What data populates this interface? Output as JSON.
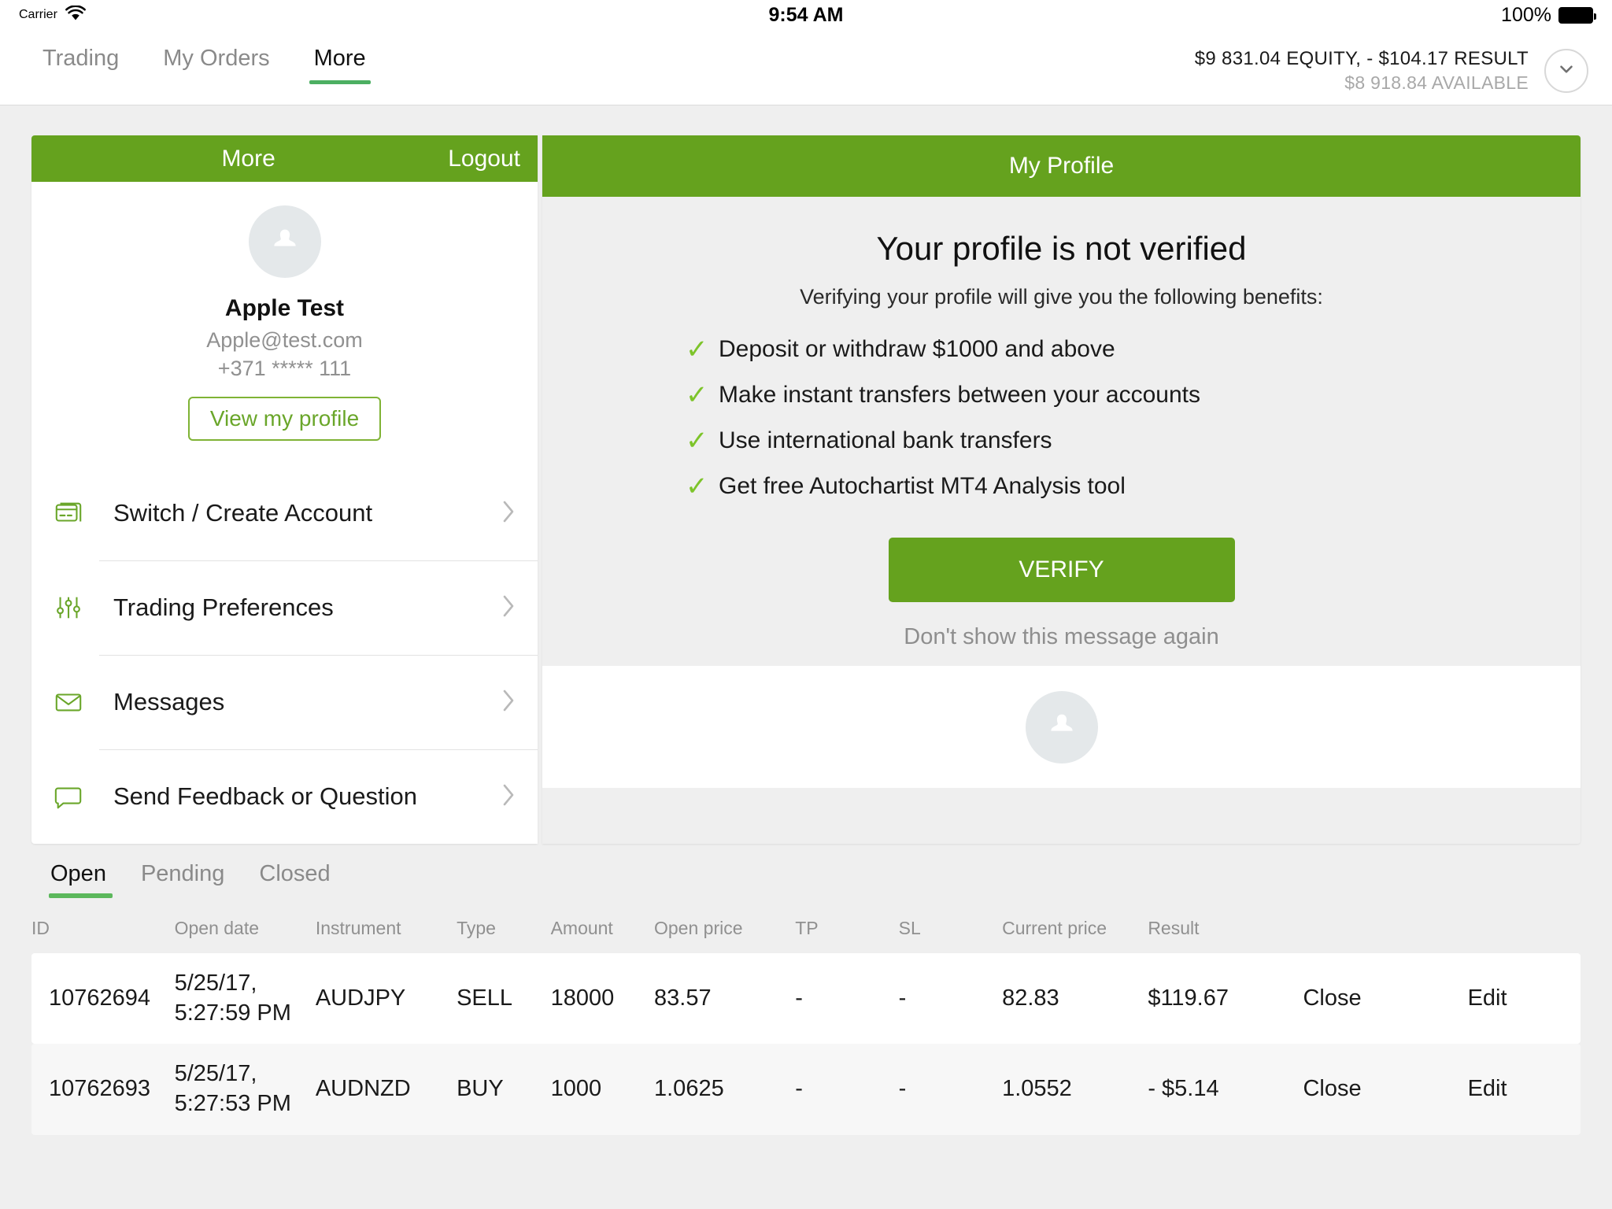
{
  "status_bar": {
    "carrier": "Carrier",
    "wifi_icon": "wifi-icon",
    "time": "9:54 AM",
    "battery_percent": "100%",
    "battery_icon": "battery-full-icon"
  },
  "top_nav": {
    "tabs": [
      {
        "label": "Trading",
        "active": false
      },
      {
        "label": "My Orders",
        "active": false
      },
      {
        "label": "More",
        "active": true
      }
    ],
    "account": {
      "equity_line": "$9 831.04 EQUITY, - $104.17 RESULT",
      "available_line": "$8 918.84 AVAILABLE",
      "expand_icon": "chevron-down-icon"
    }
  },
  "left_panel": {
    "bar_title": "More",
    "logout_label": "Logout",
    "avatar_icon": "user-avatar-icon",
    "user_name": "Apple Test",
    "user_email": "Apple@test.com",
    "user_phone": "+371 ***** 111",
    "view_profile_label": "View my profile",
    "menu": [
      {
        "label": "Switch / Create Account",
        "icon": "credit-card-icon"
      },
      {
        "label": "Trading Preferences",
        "icon": "sliders-icon"
      },
      {
        "label": "Messages",
        "icon": "envelope-icon"
      },
      {
        "label": "Send Feedback or Question",
        "icon": "speech-bubble-icon"
      }
    ],
    "chevron_icon": "chevron-right-icon"
  },
  "right_panel": {
    "bar_title": "My Profile",
    "verify_title": "Your profile is not verified",
    "verify_subtitle": "Verifying your profile will give you the following benefits:",
    "check_icon": "check-mark-icon",
    "benefits": [
      "Deposit or withdraw $1000 and above",
      "Make instant transfers between your accounts",
      "Use international bank transfers",
      "Get free Autochartist MT4 Analysis tool"
    ],
    "verify_button_label": "VERIFY",
    "dont_show_label": "Don't show this message again",
    "footer_avatar_icon": "user-avatar-icon"
  },
  "orders": {
    "tabs": [
      {
        "label": "Open",
        "active": true
      },
      {
        "label": "Pending",
        "active": false
      },
      {
        "label": "Closed",
        "active": false
      }
    ],
    "columns": [
      "ID",
      "Open date",
      "Instrument",
      "Type",
      "Amount",
      "Open price",
      "TP",
      "SL",
      "Current price",
      "Result"
    ],
    "rows": [
      {
        "id": "10762694",
        "open_date": "5/25/17,\n5:27:59 PM",
        "instrument": "AUDJPY",
        "type": "SELL",
        "amount": "18000",
        "open_price": "83.57",
        "tp": "-",
        "sl": "-",
        "current_price": "82.83",
        "result": "$119.67",
        "result_positive": true,
        "close_label": "Close",
        "edit_label": "Edit"
      },
      {
        "id": "10762693",
        "open_date": "5/25/17,\n5:27:53 PM",
        "instrument": "AUDNZD",
        "type": "BUY",
        "amount": "1000",
        "open_price": "1.0625",
        "tp": "-",
        "sl": "-",
        "current_price": "1.0552",
        "result": "- $5.14",
        "result_positive": false,
        "close_label": "Close",
        "edit_label": "Edit"
      }
    ]
  },
  "colors": {
    "brand_green": "#65a21e",
    "accent_green": "#5cb85c",
    "sell_red": "#c1275e",
    "buy_green": "#66a82a",
    "check_green": "#7dc42a",
    "page_bg": "#efefef"
  }
}
